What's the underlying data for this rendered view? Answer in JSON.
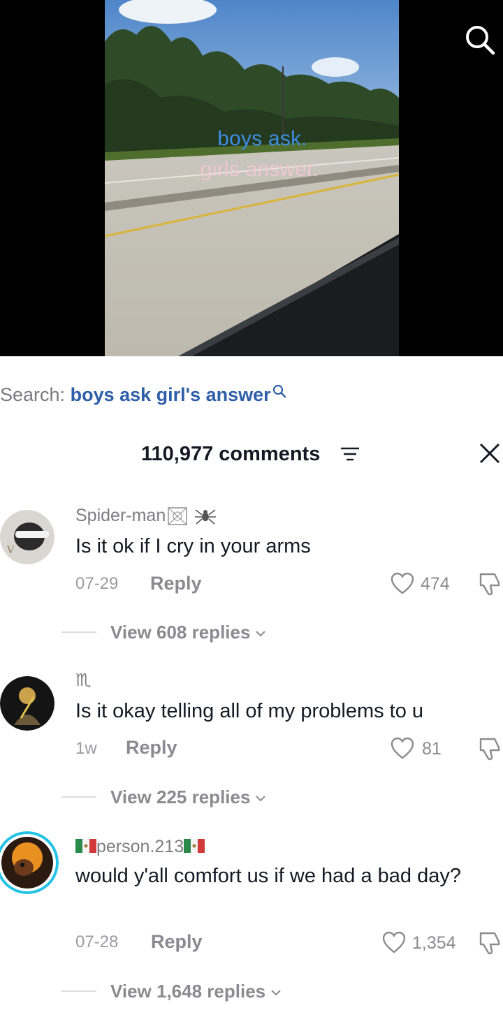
{
  "video": {
    "overlay_line1": "boys ask.",
    "overlay_line2": "girls answer."
  },
  "search": {
    "prefix": "Search:",
    "query": "boys ask girl's answer"
  },
  "comments_panel": {
    "count_label": "110,977 comments"
  },
  "comments": [
    {
      "username": "Spider-man",
      "text": "Is it ok if I cry in your arms",
      "date": "07-29",
      "reply_label": "Reply",
      "likes": "474",
      "view_replies": "View 608 replies"
    },
    {
      "username": "♏",
      "text": "Is it okay telling all of my problems to u",
      "date": "1w",
      "reply_label": "Reply",
      "likes": "81",
      "view_replies": "View 225 replies"
    },
    {
      "username": "person.213",
      "text": "would y'all comfort us if we had a bad day?",
      "date": "07-28",
      "reply_label": "Reply",
      "likes": "1,354",
      "view_replies": "View 1,648 replies"
    }
  ],
  "colors": {
    "search_query": "#2f5ea8",
    "overlay_line1": "#3d8de0",
    "overlay_line2": "#f2c9d2",
    "story_ring": "#22c3e6"
  }
}
